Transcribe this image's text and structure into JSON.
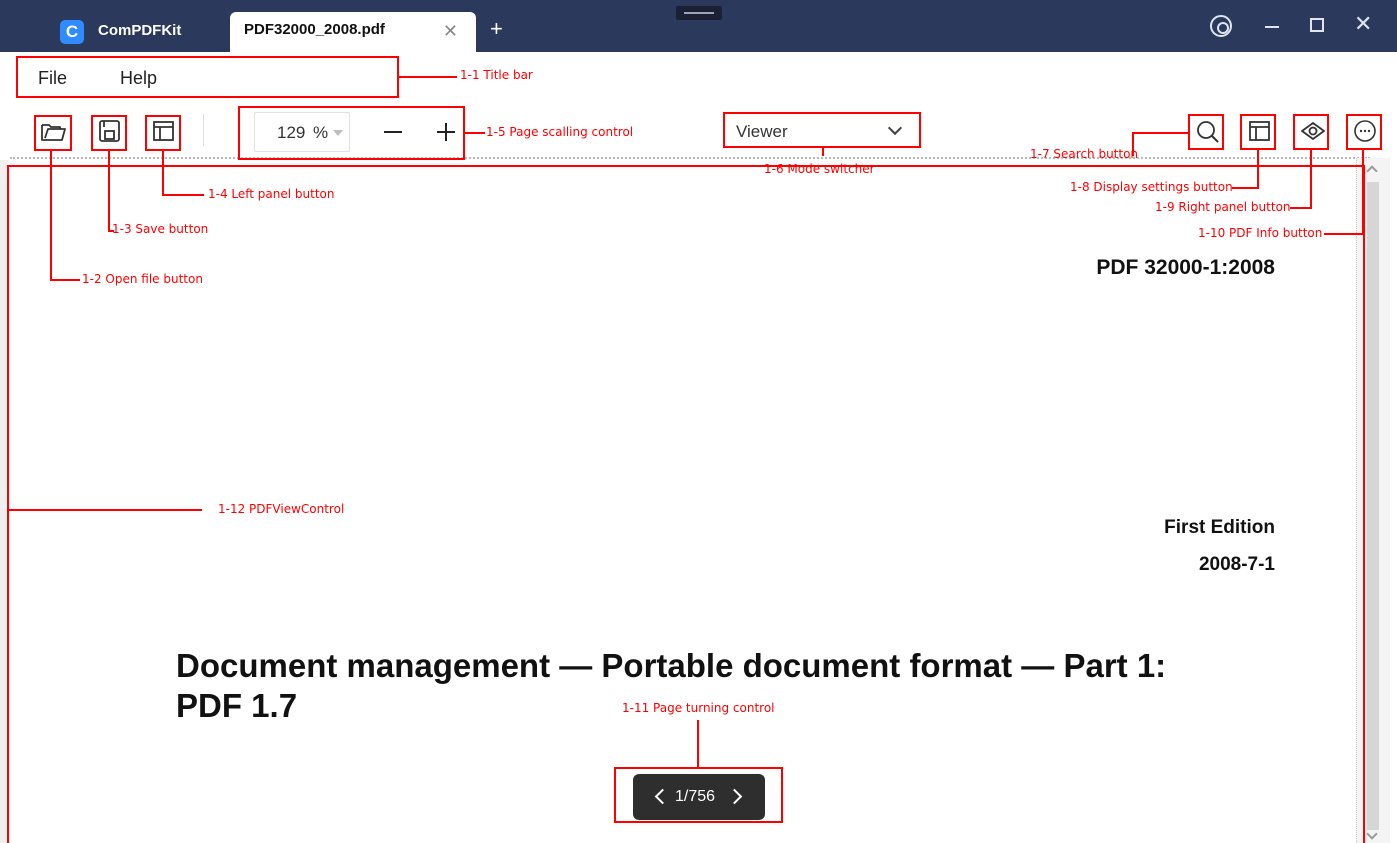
{
  "app": {
    "name": "ComPDFKit",
    "logo_letter": "C"
  },
  "tab": {
    "title": "PDF32000_2008.pdf",
    "close_glyph": "✕",
    "new_tab_glyph": "+"
  },
  "menu": {
    "items": [
      {
        "label": "File"
      },
      {
        "label": "Help"
      }
    ]
  },
  "toolbar": {
    "zoom": {
      "value": "129",
      "unit": "%"
    },
    "mode": {
      "selected": "Viewer"
    }
  },
  "document": {
    "number": "PDF 32000-1:2008",
    "edition": "First Edition",
    "date": "2008-7-1",
    "title_line1": "Document management — Portable document format — Part 1:",
    "title_line2": "PDF 1.7"
  },
  "pagination": {
    "indicator": "1/756"
  },
  "annotations": {
    "title_bar": "1-1 Title bar",
    "open_file": "1-2 Open file button",
    "save": "1-3 Save button",
    "left_panel": "1-4 Left panel button",
    "scaling": "1-5 Page scalling control",
    "mode_switcher": "1-6 Mode switcher",
    "search": "1-7 Search button",
    "display_settings": "1-8 Display settings button",
    "right_panel": "1-9 Right panel button",
    "pdf_info": "1-10 PDF Info button",
    "page_turning": "1-11 Page turning control",
    "pdf_view_control": "1-12 PDFViewControl"
  },
  "colors": {
    "titlebar": "#2b3a5c",
    "accent": "#2f8bff",
    "annotation": "#ff0000",
    "page_turn_bg": "#2e2e2e"
  }
}
